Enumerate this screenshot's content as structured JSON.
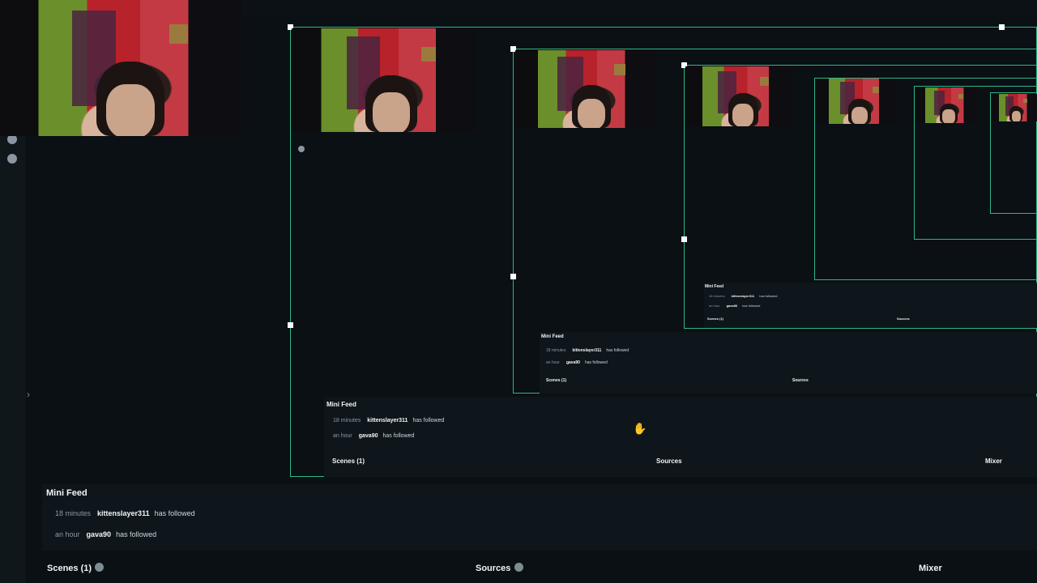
{
  "mini_feed": {
    "title": "Mini Feed",
    "items": [
      {
        "time": "18 minutes",
        "user": "kittenslayer311",
        "action": "has followed"
      },
      {
        "time": "an hour",
        "user": "gava90",
        "action": "has followed"
      }
    ]
  },
  "docks": {
    "scenes_label": "Scenes (1)",
    "sources_label": "Sources",
    "mixer_label": "Mixer"
  },
  "recursion": {
    "mini_feed_title": "Mini Feed",
    "item1_time": "18 minutes",
    "item1_user": "kittenslayer311",
    "item1_action": "has followed",
    "item2_time": "an hour",
    "item2_user": "gava90",
    "item2_action": "has followed",
    "scenes_label": "Scenes (1)",
    "sources_label": "Sources",
    "mixer_label": "Mixer"
  },
  "colors": {
    "background": "#0a1014",
    "accent": "#2fb58a",
    "panel": "#0e161b",
    "text": "#f1f5f7",
    "muted": "#8c989f"
  },
  "icons": [
    "hand-cursor-icon",
    "add-scene-icon",
    "add-source-icon",
    "mixer-icon"
  ]
}
